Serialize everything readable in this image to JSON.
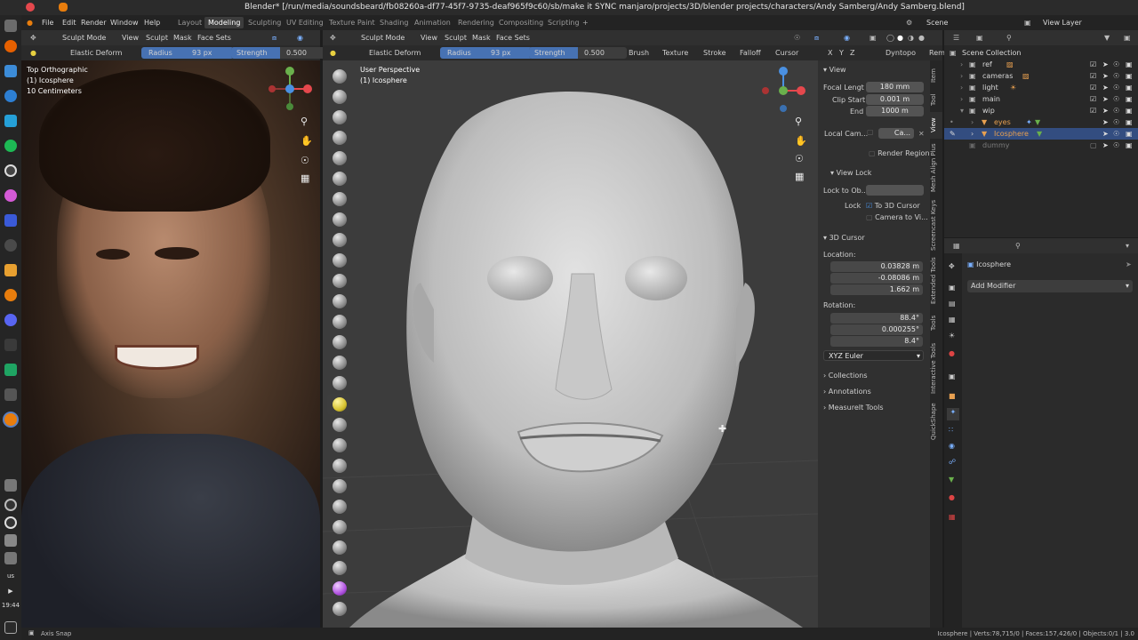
{
  "window": {
    "title": "Blender* [/run/media/soundsbeard/fb08260a-df77-45f7-9735-deaf965f9c60/sb/make it SYNC manjaro/projects/3D/blender projects/characters/Andy Samberg/Andy Samberg.blend]"
  },
  "menu": {
    "items": [
      "File",
      "Edit",
      "Render",
      "Window",
      "Help"
    ],
    "workspaces": [
      "Layout",
      "Modeling",
      "Sculpting",
      "UV Editing",
      "Texture Paint",
      "Shading",
      "Animation",
      "Rendering",
      "Compositing",
      "Scripting"
    ],
    "active_workspace": "Modeling",
    "add": "+",
    "scene": "Scene",
    "view_layer": "View Layer"
  },
  "left_header": {
    "mode": "Sculpt Mode",
    "items": [
      "View",
      "Sculpt",
      "Mask",
      "Face Sets"
    ]
  },
  "left_tool": {
    "brush": "Elastic Deform",
    "radius_label": "Radius",
    "radius_value": "93 px",
    "strength_label": "Strength",
    "strength_value": "0.500"
  },
  "left_view": {
    "line1": "Top Orthographic",
    "line2": "(1) Icosphere",
    "line3": "10 Centimeters"
  },
  "main_header": {
    "mode": "Sculpt Mode",
    "items": [
      "View",
      "Sculpt",
      "Mask",
      "Face Sets"
    ],
    "dyntopo": "Dyntopo",
    "remesh": "Rem"
  },
  "main_tool": {
    "brush": "Elastic Deform",
    "radius_label": "Radius",
    "radius_value": "93 px",
    "strength_label": "Strength",
    "strength_value": "0.500",
    "brush_menu": "Brush",
    "texture_menu": "Texture",
    "stroke_menu": "Stroke",
    "falloff_menu": "Falloff",
    "cursor_menu": "Cursor"
  },
  "main_view": {
    "line1": "User Perspective",
    "line2": "(1) Icosphere"
  },
  "npanel": {
    "view_header": "View",
    "focal_label": "Focal Lengt",
    "focal_value": "180 mm",
    "clip_start_label": "Clip Start",
    "clip_start_value": "0.001 m",
    "clip_end_label": "End",
    "clip_end_value": "1000 m",
    "local_cam_label": "Local Cam...",
    "local_cam_value": "Ca...",
    "render_region": "Render Region",
    "view_lock_header": "View Lock",
    "lock_to_label": "Lock to Ob...",
    "lock_label": "Lock",
    "to_3d_cursor": "To 3D Cursor",
    "camera_to_view": "Camera to Vi...",
    "cursor_header": "3D Cursor",
    "location_label": "Location:",
    "loc_x": "0.03828 m",
    "loc_y": "-0.08086 m",
    "loc_z": "1.662 m",
    "rotation_label": "Rotation:",
    "rot_x": "88.4°",
    "rot_y": "0.000255°",
    "rot_z": "8.4°",
    "rot_mode": "XYZ Euler",
    "collections": "Collections",
    "annotations": "Annotations",
    "measureit": "MeasureIt Tools",
    "axis_x": "X",
    "axis_y": "Y",
    "axis_z": "Z"
  },
  "vtabs": [
    "Item",
    "Tool",
    "View",
    "Mesh Align Plus",
    "Screencast Keys",
    "Extended Tools",
    "Tools",
    "Interactive Tools",
    "QuickShape"
  ],
  "outliner": {
    "root": "Scene Collection",
    "rows": [
      {
        "name": "ref",
        "color": "#d8d8d8"
      },
      {
        "name": "cameras",
        "color": "#d8d8d8"
      },
      {
        "name": "light",
        "color": "#d8d8d8"
      },
      {
        "name": "main",
        "color": "#d8d8d8"
      },
      {
        "name": "wip",
        "color": "#d8d8d8"
      },
      {
        "name": "eyes",
        "color": "#e8a050"
      },
      {
        "name": "Icosphere",
        "color": "#e8a050"
      },
      {
        "name": "dummy",
        "color": "#7a7a7a"
      }
    ]
  },
  "properties": {
    "object_name": "Icosphere",
    "add_modifier": "Add Modifier"
  },
  "status": {
    "left": "Axis Snap",
    "right": "Icosphere | Verts:78,715/0 | Faces:157,426/0 | Objects:0/1 | 3.0"
  },
  "taskbar": {
    "lang": "us",
    "clock": "19:44"
  }
}
